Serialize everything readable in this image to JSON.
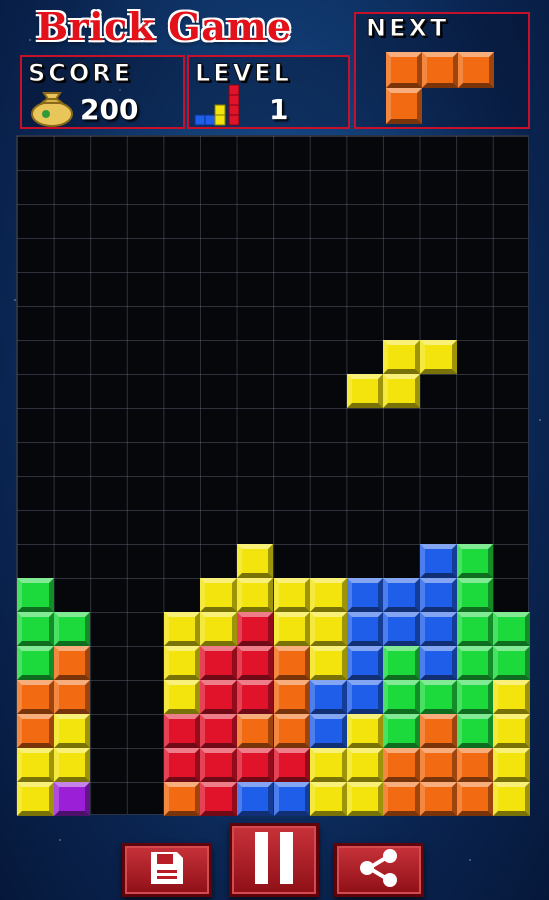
{
  "game": {
    "title": "Brick Game",
    "score_label": "SCORE",
    "score": "200",
    "level_label": "LEVEL",
    "level": "1",
    "next_label": "NEXT"
  },
  "colors": {
    "yellow": "#f2e40c",
    "orange": "#f26a12",
    "red": "#e0132b",
    "green": "#1cd93c",
    "blue": "#1f5ee8",
    "purple": "#9a1fd6"
  },
  "board": {
    "columns": 14,
    "rows": 20,
    "settled_rows_from_bottom": [
      [
        "yellow",
        "purple",
        null,
        null,
        "orange",
        "red",
        "blue",
        "blue",
        "yellow",
        "yellow",
        "orange",
        "orange",
        "orange",
        "yellow"
      ],
      [
        "yellow",
        "yellow",
        null,
        null,
        "red",
        "red",
        "red",
        "red",
        "yellow",
        "yellow",
        "orange",
        "orange",
        "orange",
        "yellow"
      ],
      [
        "orange",
        "yellow",
        null,
        null,
        "red",
        "red",
        "orange",
        "orange",
        "blue",
        "yellow",
        "green",
        "orange",
        "green",
        "yellow"
      ],
      [
        "orange",
        "orange",
        null,
        null,
        "yellow",
        "red",
        "red",
        "orange",
        "blue",
        "blue",
        "green",
        "green",
        "green",
        "yellow"
      ],
      [
        "green",
        "orange",
        null,
        null,
        "yellow",
        "red",
        "red",
        "orange",
        "yellow",
        "blue",
        "green",
        "blue",
        "green",
        "green"
      ],
      [
        "green",
        "green",
        null,
        null,
        "yellow",
        "yellow",
        "red",
        "yellow",
        "yellow",
        "blue",
        "blue",
        "blue",
        "green",
        "green"
      ],
      [
        "green",
        null,
        null,
        null,
        null,
        "yellow",
        "yellow",
        "yellow",
        "yellow",
        "blue",
        "blue",
        "blue",
        "green",
        null
      ],
      [
        null,
        null,
        null,
        null,
        null,
        null,
        "yellow",
        null,
        null,
        null,
        null,
        "blue",
        "green",
        null
      ]
    ],
    "falling_piece": {
      "shape": "S",
      "color": "yellow",
      "cells": [
        [
          10,
          6
        ],
        [
          11,
          6
        ],
        [
          9,
          7
        ],
        [
          10,
          7
        ]
      ]
    }
  },
  "next_piece": {
    "shape": "L",
    "color": "orange",
    "cells": [
      [
        0,
        0
      ],
      [
        1,
        0
      ],
      [
        2,
        0
      ],
      [
        0,
        1
      ]
    ]
  },
  "buttons": {
    "save": "save-icon",
    "pause": "pause-icon",
    "share": "share-icon"
  }
}
